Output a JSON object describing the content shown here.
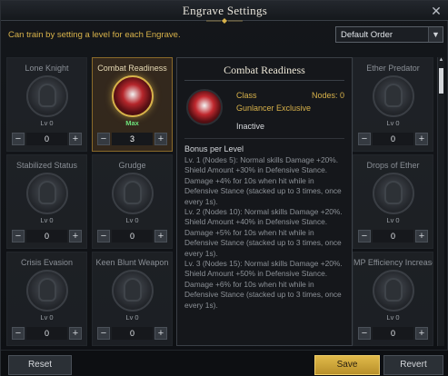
{
  "window": {
    "title": "Engrave Settings"
  },
  "hint": "Can train by setting a level for each Engrave.",
  "sort": {
    "selected": "Default Order"
  },
  "engravings": [
    {
      "name": "Lone Knight",
      "level": "Lv 0",
      "value": "0"
    },
    {
      "name": "Combat Readiness",
      "level": "Max",
      "value": "3"
    },
    {
      "name": "Ether Predator",
      "level": "Lv 0",
      "value": "0"
    },
    {
      "name": "Stabilized Status",
      "level": "Lv 0",
      "value": "0"
    },
    {
      "name": "Grudge",
      "level": "Lv 0",
      "value": "0"
    },
    {
      "name": "Drops of Ether",
      "level": "Lv 0",
      "value": "0"
    },
    {
      "name": "Crisis Evasion",
      "level": "Lv 0",
      "value": "0"
    },
    {
      "name": "Keen Blunt Weapon",
      "level": "Lv 0",
      "value": "0"
    },
    {
      "name": "MP Efficiency Increase",
      "level": "Lv 0",
      "value": "0"
    }
  ],
  "tooltip": {
    "title": "Combat Readiness",
    "class_label": "Class",
    "nodes": "Nodes: 0",
    "exclusive": "Gunlancer Exclusive",
    "state": "Inactive",
    "bonus_heading": "Bonus per Level",
    "levels": [
      "Lv. 1 (Nodes 5): Normal skills Damage +20%. Shield Amount +30% in Defensive Stance. Damage +4% for 10s when hit while in Defensive Stance (stacked up to 3 times, once every 1s).",
      "Lv. 2 (Nodes 10): Normal skills Damage +20%. Shield Amount +40% in Defensive Stance. Damage +5% for 10s when hit while in Defensive Stance (stacked up to 3 times, once every 1s).",
      "Lv. 3 (Nodes 15): Normal skills Damage +20%. Shield Amount +50% in Defensive Stance. Damage +6% for 10s when hit while in Defensive Stance (stacked up to 3 times, once every 1s)."
    ]
  },
  "footer": {
    "reset": "Reset",
    "save": "Save",
    "revert": "Revert"
  },
  "icons": {
    "close": "close-icon",
    "dropdown": "chevron-down-icon",
    "minus": "minus-icon",
    "plus": "plus-icon"
  },
  "colors": {
    "accent": "#d8b24a",
    "max_level": "#6de07a"
  }
}
